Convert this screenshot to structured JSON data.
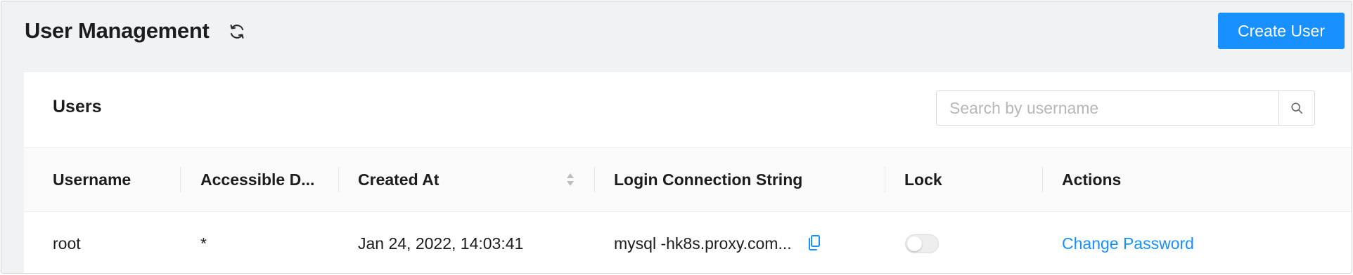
{
  "header": {
    "title": "User Management",
    "refresh_icon": "refresh-icon",
    "create_button_label": "Create User"
  },
  "card": {
    "title": "Users",
    "search": {
      "placeholder": "Search by username",
      "icon": "search-icon"
    }
  },
  "table": {
    "columns": [
      "Username",
      "Accessible D...",
      "Created At",
      "Login Connection String",
      "Lock",
      "Actions"
    ],
    "rows": [
      {
        "username": "root",
        "accessible_databases": "*",
        "created_at": "Jan 24, 2022, 14:03:41",
        "login_connection_string": "mysql -hk8s.proxy.com...",
        "locked": false,
        "action_label": "Change Password"
      }
    ]
  },
  "colors": {
    "primary": "#1890ff",
    "page_background": "#f1f2f5",
    "table_header_background": "#fafafa"
  }
}
